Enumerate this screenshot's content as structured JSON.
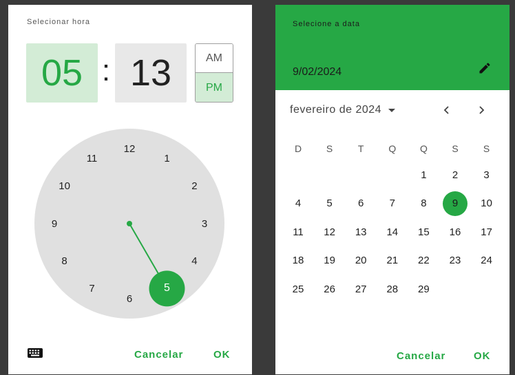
{
  "time_picker": {
    "title": "Selecionar hora",
    "hour": "05",
    "separator": ":",
    "minute": "13",
    "am_label": "AM",
    "pm_label": "PM",
    "selected_period": "PM",
    "selected_hour": "5",
    "clock_numbers": [
      "12",
      "1",
      "2",
      "3",
      "4",
      "5",
      "6",
      "7",
      "8",
      "9",
      "10",
      "11"
    ],
    "cancel_label": "Cancelar",
    "ok_label": "OK",
    "keyboard_icon": "keyboard-icon"
  },
  "date_picker": {
    "title": "Selecione a data",
    "selected_date": "9/02/2024",
    "edit_icon": "edit-icon",
    "month_label": "fevereiro de 2024",
    "weekdays": [
      "D",
      "S",
      "T",
      "Q",
      "Q",
      "S",
      "S"
    ],
    "weeks": [
      [
        "",
        "",
        "",
        "",
        "1",
        "2",
        "3"
      ],
      [
        "4",
        "5",
        "6",
        "7",
        "8",
        "9",
        "10"
      ],
      [
        "11",
        "12",
        "13",
        "14",
        "15",
        "16",
        "17"
      ],
      [
        "18",
        "19",
        "20",
        "21",
        "22",
        "23",
        "24"
      ],
      [
        "25",
        "26",
        "27",
        "28",
        "29",
        "",
        ""
      ]
    ],
    "selected_day": "9",
    "cancel_label": "Cancelar",
    "ok_label": "OK"
  },
  "colors": {
    "accent": "#26a845",
    "accent_light": "#d3ecd6",
    "backdrop": "#3a3a3a"
  }
}
